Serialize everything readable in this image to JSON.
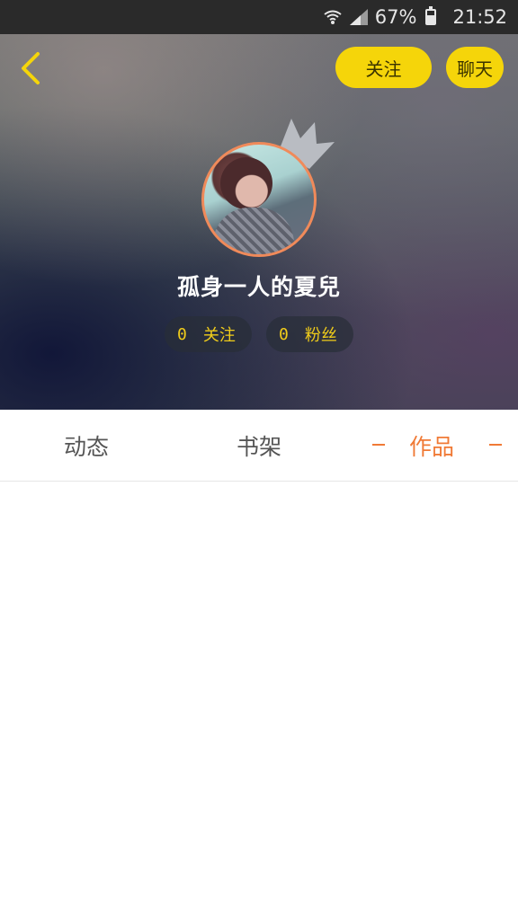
{
  "status_bar": {
    "battery": "67%",
    "battery_level": 0.67,
    "time": "21:52"
  },
  "header": {
    "back_icon": "chevron-left-icon",
    "follow_label": "关注",
    "chat_label": "聊天"
  },
  "profile": {
    "username": "孤身一人的夏兒",
    "following_count": "0",
    "following_label": "关注",
    "fans_count": "0",
    "fans_label": "粉丝"
  },
  "tabs": [
    {
      "label": "动态",
      "active": false
    },
    {
      "label": "书架",
      "active": false
    },
    {
      "label": "作品",
      "active": true
    }
  ],
  "colors": {
    "accent_yellow": "#f5d50a",
    "active_tab": "#f07a36",
    "avatar_ring": "#f08a5a"
  }
}
